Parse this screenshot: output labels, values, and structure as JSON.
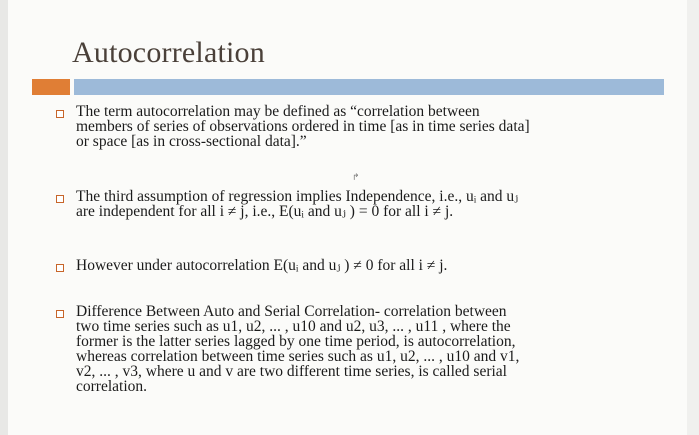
{
  "title": "Autocorrelation",
  "colors": {
    "accent": "#e07e35",
    "title_bar": "#9dbad9",
    "bullet": "#c7652a"
  },
  "bullets": [
    {
      "lines": [
        "The term  autocorrelation may be defined as “correlation between",
        "members of series of observations ordered in time [as in time series data]",
        "or space [as in cross-sectional data].”"
      ]
    },
    {
      "lines": [
        "The third assumption of regression implies Independence, i.e., uᵢ and uⱼ",
        "are independent for all i ≠ j, i.e., E(uᵢ and uⱼ ) = 0 for all i ≠ j."
      ]
    },
    {
      "lines": [
        "However under autocorrelation E(uᵢ and uⱼ ) ≠ 0 for all i ≠ j."
      ]
    },
    {
      "lines": [
        "Difference Between Auto and Serial Correlation-  correlation between",
        "two time series such as u1, u2, ... , u10 and u2, u3, ... , u11 , where the",
        "former is the latter series lagged by one time period, is autocorrelation,",
        "whereas correlation between time series such as  u1, u2, ... , u10 and v1,",
        "v2, ... , v3, where u and v are two different time series, is called serial",
        "correlation."
      ]
    }
  ],
  "cursor_glyph": "↱"
}
